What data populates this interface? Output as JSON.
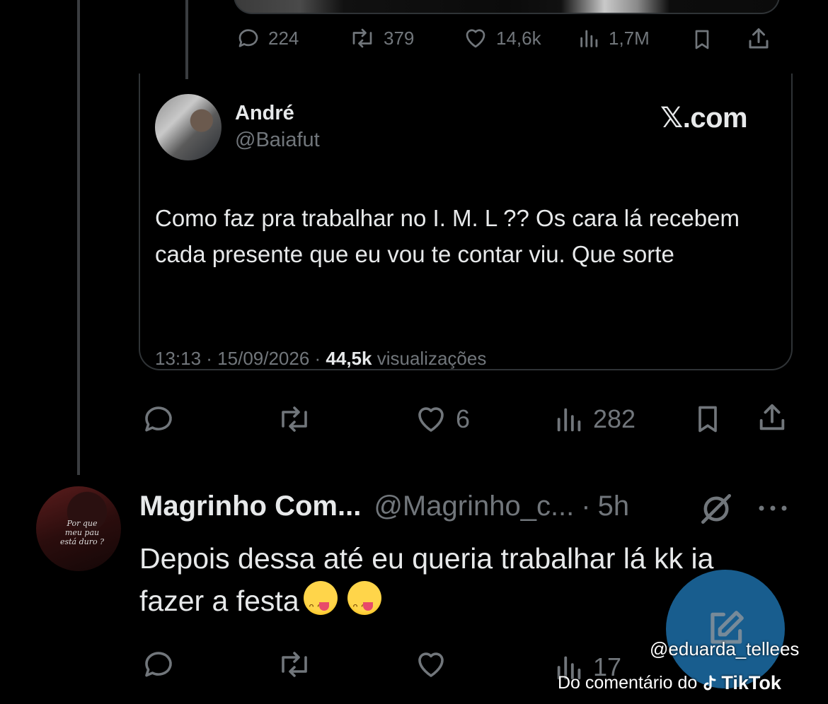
{
  "top_stats": {
    "replies": "224",
    "retweets": "379",
    "likes": "14,6k",
    "views": "1,7M"
  },
  "quoted_tweet": {
    "author_name": "André",
    "author_handle": "@Baiafut",
    "brand": "𝕏.com",
    "text": "Como faz pra trabalhar no I. M. L ?? Os cara lá recebem cada presente que eu vou te contar viu. Que sorte",
    "time": "13:13 · 15/09/2026 · ",
    "views_count": "44,5k",
    "views_label": " visualizações"
  },
  "post_stats": {
    "likes": "6",
    "views": "282"
  },
  "reply": {
    "author_name": "Magrinho Com...",
    "author_handle": "@Magrinho_c...",
    "separator": "·",
    "time": "5h",
    "text_line1": "Depois dessa até eu queria trabalhar lá kk ia",
    "text_line2": "fazer a festa",
    "avatar_caption": "Por que meu pau está duro ?",
    "views": "17"
  },
  "watermark": {
    "user": "@eduarda_tellees",
    "source": "Do comentário do",
    "app": "TikTok"
  },
  "colors": {
    "background": "#000000",
    "text": "#e7e9ea",
    "muted": "#71767b",
    "border": "#2f3336",
    "fab": "#1d6ea7"
  }
}
